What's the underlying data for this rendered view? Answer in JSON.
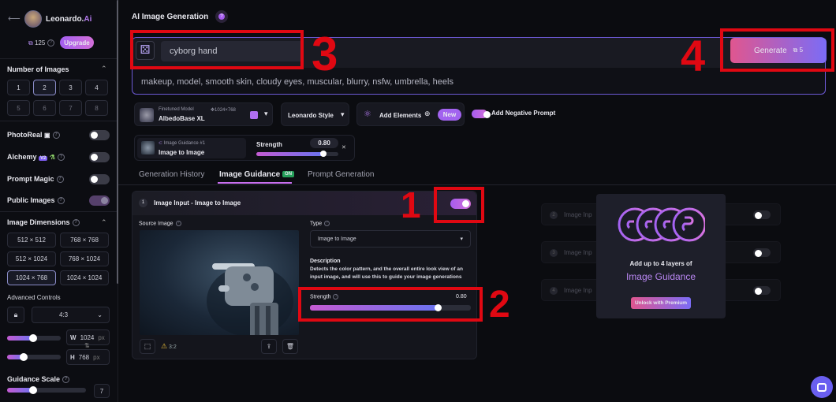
{
  "brand": {
    "name": "Leonardo.",
    "suffix": "Ai"
  },
  "tokens": {
    "count": "125",
    "upgrade": "Upgrade"
  },
  "sidebar": {
    "num_images_label": "Number of Images",
    "num_options": [
      "1",
      "2",
      "3",
      "4",
      "5",
      "6",
      "7",
      "8"
    ],
    "photoreal": "PhotoReal",
    "alchemy": "Alchemy",
    "alchemy_badge": "V2",
    "prompt_magic": "Prompt Magic",
    "public_images": "Public Images",
    "image_dimensions": "Image Dimensions",
    "dims": [
      "512 × 512",
      "768 × 768",
      "512 × 1024",
      "768 × 1024",
      "1024 × 768",
      "1024 × 1024"
    ],
    "advanced_controls": "Advanced Controls",
    "aspect": "4:3",
    "w_label": "W",
    "w_value": "1024",
    "h_label": "H",
    "h_value": "768",
    "px": "px",
    "guidance_scale": "Guidance Scale",
    "guidance_value": "7"
  },
  "header": {
    "title": "AI Image Generation"
  },
  "prompt": {
    "value": "cyborg hand",
    "negative": "makeup, model, smooth skin, cloudy eyes, muscular, blurry, nsfw, umbrella, heels"
  },
  "generate": {
    "label": "Generate",
    "cost": "5"
  },
  "model": {
    "caption": "Finetuned Model",
    "size": "1024×768",
    "name": "AlbedoBase XL"
  },
  "style": {
    "label": "Leonardo Style"
  },
  "elements": {
    "label": "Add Elements",
    "badge": "New"
  },
  "negative_toggle": {
    "label": "Add Negative Prompt"
  },
  "guidance_chip": {
    "caption": "Image Guidance #1",
    "name": "Image to Image",
    "strength_label": "Strength",
    "strength_value": "0.80"
  },
  "tabs": [
    {
      "label": "Generation History"
    },
    {
      "label": "Image Guidance",
      "badge": "ON"
    },
    {
      "label": "Prompt Generation"
    }
  ],
  "panel": {
    "num": "1",
    "title": "Image Input - Image to Image",
    "source_label": "Source Image",
    "type_label": "Type",
    "type_value": "Image to Image",
    "desc_label": "Description",
    "desc_text": "Detects the color pattern, and the overall entire look view of an input image, and will use this to guide your image generations",
    "strength_label": "Strength",
    "strength_value": "0.80",
    "strength": 0.8,
    "ratio": "3:2"
  },
  "ghost_rows": [
    {
      "num": "2",
      "label": "Image Inp"
    },
    {
      "num": "3",
      "label": "Image Inp"
    },
    {
      "num": "4",
      "label": "Image Inp"
    }
  ],
  "promo": {
    "line1": "Add up to 4 layers of",
    "line2": "Image Guidance",
    "button": "Unlock with Premium"
  },
  "annotations": [
    "1",
    "2",
    "3",
    "4"
  ],
  "colors": {
    "accent": "#a65cf0",
    "annotation": "#e00812",
    "generate_from": "#e0568f",
    "generate_to": "#7b6cf6"
  }
}
